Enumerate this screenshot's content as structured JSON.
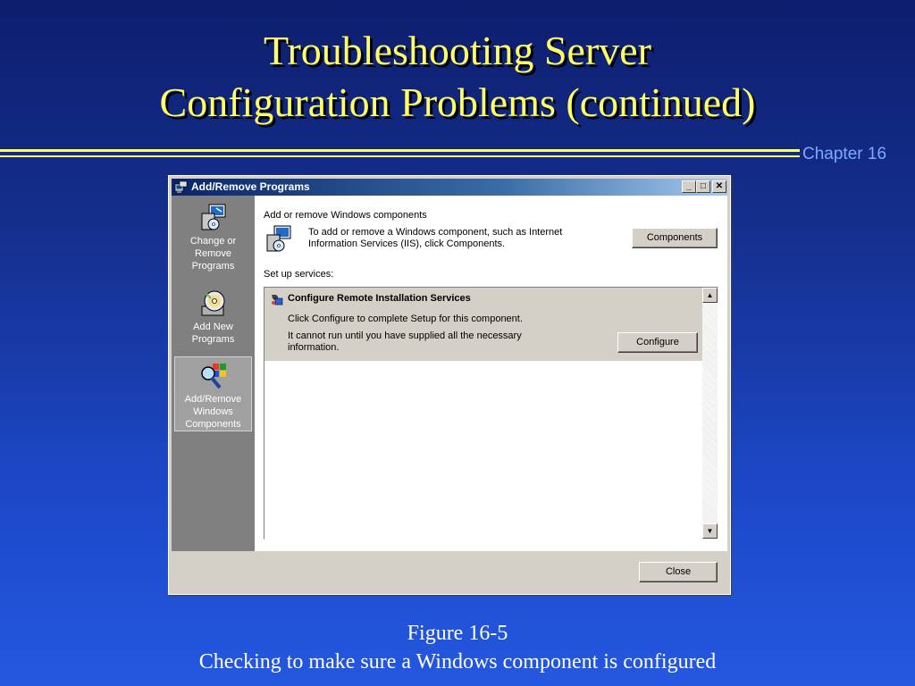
{
  "slide": {
    "title_line1": "Troubleshooting Server",
    "title_line2": "Configuration Problems (continued)",
    "chapter": "Chapter 16",
    "figure_label": "Figure 16-5",
    "figure_caption": "Checking to make sure a Windows component is configured"
  },
  "window": {
    "title": "Add/Remove Programs",
    "minimize_glyph": "_",
    "maximize_glyph": "□",
    "close_glyph": "✕"
  },
  "sidebar": {
    "items": [
      {
        "label_line1": "Change or",
        "label_line2": "Remove",
        "label_line3": "Programs",
        "icon": "change-remove-icon"
      },
      {
        "label_line1": "Add New",
        "label_line2": "Programs",
        "icon": "cd-install-icon"
      },
      {
        "label_line1": "Add/Remove",
        "label_line2": "Windows",
        "label_line3": "Components",
        "icon": "windows-components-icon",
        "selected": true
      }
    ]
  },
  "content": {
    "components_section_title": "Add or remove Windows components",
    "components_desc_line1": "To add or remove a Windows component, such as Internet",
    "components_desc_line2": "Information Services (IIS), click Components.",
    "components_button": "Components",
    "services_section_title": "Set up services:",
    "service_item": {
      "title": "Configure Remote Installation Services",
      "line1": "Click Configure to complete Setup for this component.",
      "line2a": "It cannot run until you have supplied all the necessary",
      "line2b": "information.",
      "configure_button": "Configure"
    }
  },
  "footer": {
    "close_button": "Close"
  },
  "colors": {
    "title_yellow": "#ffff66",
    "chapter_blue": "#7fa8ff",
    "titlebar_start": "#0a246a",
    "sidebar_gray": "#808080",
    "dialog_face": "#d4d0c8"
  }
}
